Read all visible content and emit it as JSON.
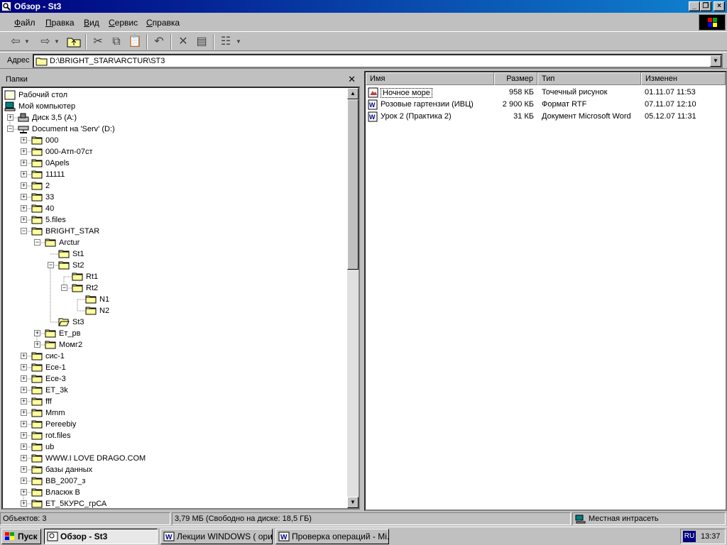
{
  "window": {
    "title": "Обзор - St3"
  },
  "menu": [
    {
      "label": "Файл",
      "key": "Ф",
      "rest": "айл"
    },
    {
      "label": "Правка",
      "key": "П",
      "rest": "равка"
    },
    {
      "label": "Вид",
      "key": "В",
      "rest": "ид"
    },
    {
      "label": "Сервис",
      "key": "С",
      "rest": "ервис"
    },
    {
      "label": "Справка",
      "key": "С",
      "rest": "правка"
    }
  ],
  "address": {
    "label": "Адрес",
    "value": "D:\\BRIGHT_STAR\\ARCTUR\\ST3"
  },
  "left_pane": {
    "title": "Папки"
  },
  "tree": [
    {
      "label": "Рабочий стол",
      "icon": "desktop",
      "level": 0,
      "exp": ""
    },
    {
      "label": "Мой компьютер",
      "icon": "computer",
      "level": 0,
      "exp": "-"
    },
    {
      "label": "Диск 3,5 (A:)",
      "icon": "floppy",
      "level": 1,
      "exp": "+"
    },
    {
      "label": "Document на 'Serv' (D:)",
      "icon": "netdrive",
      "level": 1,
      "exp": "-"
    },
    {
      "label": "000",
      "icon": "folder",
      "level": 2,
      "exp": "+"
    },
    {
      "label": "000-Атп-07ст",
      "icon": "folder",
      "level": 2,
      "exp": "+"
    },
    {
      "label": "0Apels",
      "icon": "folder",
      "level": 2,
      "exp": "+"
    },
    {
      "label": "11111",
      "icon": "folder",
      "level": 2,
      "exp": "+"
    },
    {
      "label": "2",
      "icon": "folder",
      "level": 2,
      "exp": "+"
    },
    {
      "label": "33",
      "icon": "folder",
      "level": 2,
      "exp": "+"
    },
    {
      "label": "40",
      "icon": "folder",
      "level": 2,
      "exp": "+"
    },
    {
      "label": "5.files",
      "icon": "folder",
      "level": 2,
      "exp": "+"
    },
    {
      "label": "BRIGHT_STAR",
      "icon": "folder",
      "level": 2,
      "exp": "-"
    },
    {
      "label": "Arctur",
      "icon": "folder",
      "level": 3,
      "exp": "-"
    },
    {
      "label": "St1",
      "icon": "folder",
      "level": 4,
      "exp": ""
    },
    {
      "label": "St2",
      "icon": "folder",
      "level": 4,
      "exp": "-"
    },
    {
      "label": "Rt1",
      "icon": "folder",
      "level": 5,
      "exp": ""
    },
    {
      "label": "Rt2",
      "icon": "folder",
      "level": 5,
      "exp": "-"
    },
    {
      "label": "N1",
      "icon": "folder",
      "level": 6,
      "exp": ""
    },
    {
      "label": "N2",
      "icon": "folder",
      "level": 6,
      "exp": ""
    },
    {
      "label": "St3",
      "icon": "folder-open",
      "level": 4,
      "exp": ""
    },
    {
      "label": "Ет_рв",
      "icon": "folder",
      "level": 3,
      "exp": "+"
    },
    {
      "label": "Момг2",
      "icon": "folder",
      "level": 3,
      "exp": "+"
    },
    {
      "label": "сис-1",
      "icon": "folder",
      "level": 2,
      "exp": "+"
    },
    {
      "label": "Ece-1",
      "icon": "folder",
      "level": 2,
      "exp": "+"
    },
    {
      "label": "Ece-3",
      "icon": "folder",
      "level": 2,
      "exp": "+"
    },
    {
      "label": "ET_3k",
      "icon": "folder",
      "level": 2,
      "exp": "+"
    },
    {
      "label": "fff",
      "icon": "folder",
      "level": 2,
      "exp": "+"
    },
    {
      "label": "Mmm",
      "icon": "folder",
      "level": 2,
      "exp": "+"
    },
    {
      "label": "Pereebiy",
      "icon": "folder",
      "level": 2,
      "exp": "+"
    },
    {
      "label": "rot.files",
      "icon": "folder",
      "level": 2,
      "exp": "+"
    },
    {
      "label": "ub",
      "icon": "folder",
      "level": 2,
      "exp": "+"
    },
    {
      "label": "WWW.I LOVE DRAGO.COM",
      "icon": "folder",
      "level": 2,
      "exp": "+"
    },
    {
      "label": "базы данных",
      "icon": "folder",
      "level": 2,
      "exp": "+"
    },
    {
      "label": "BB_2007_з",
      "icon": "folder",
      "level": 2,
      "exp": "+"
    },
    {
      "label": "Власюк В",
      "icon": "folder",
      "level": 2,
      "exp": "+"
    },
    {
      "label": "ET_5КУРС_грСА",
      "icon": "folder",
      "level": 2,
      "exp": "+"
    }
  ],
  "list": {
    "columns": [
      "Имя",
      "Размер",
      "Тип",
      "Изменен"
    ],
    "rows": [
      {
        "name": "Ночное море",
        "size": "958 КБ",
        "type": "Точечный рисунок",
        "modified": "01.11.07 11:53",
        "icon": "paint"
      },
      {
        "name": "Розовые гартензии (ИВЦ)",
        "size": "2 900 КБ",
        "type": "Формат RTF",
        "modified": "07.11.07 12:10",
        "icon": "word"
      },
      {
        "name": "Урок 2 (Практика 2)",
        "size": "31 КБ",
        "type": "Документ Microsoft Word",
        "modified": "05.12.07 11:31",
        "icon": "word"
      }
    ]
  },
  "status": {
    "objects": "Объектов: 3",
    "size": "3,79 МБ (Свободно на диске: 18,5 ГБ)",
    "zone": "Местная интрасеть"
  },
  "taskbar": {
    "start": "Пуск",
    "tasks": [
      "Обзор - St3",
      "Лекции WINDOWS ( ори...",
      "Проверка операций - Mi..."
    ],
    "lang": "RU",
    "clock": "13:37"
  },
  "colors": {
    "titlebar": "#000080",
    "face": "#c0c0c0",
    "folder": "#ffff9c"
  }
}
